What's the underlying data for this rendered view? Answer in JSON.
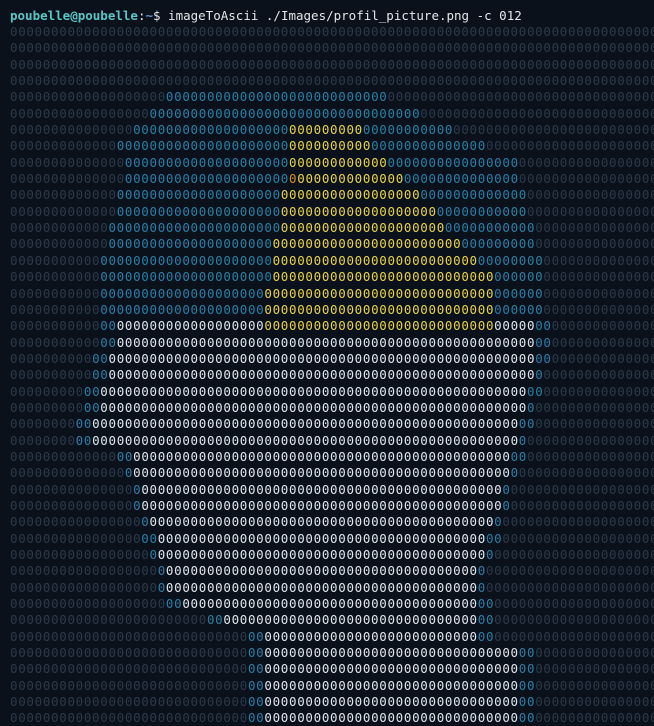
{
  "prompt": {
    "user_host": "poubelle@poubelle",
    "separator": ":",
    "path": "~",
    "symbol": "$",
    "command": " imageToAscii ./Images/profil_picture.png -c 012"
  },
  "ascii": {
    "columns": 79,
    "rows": [
      "0000000000000000000000000000000000000000000000000000000000000000000000000000000",
      "0000000000000000000000000000000000000000000000000000000000000000000000000000000",
      "0000000000000000000000000000000000000000000000000000000000000000000000000000000",
      "0000000000000000000000000000000000000000000000000000000000000000000000000000000",
      "0000000000000000000000000000000000000000000000000000000000000000000000000000000",
      "0000000000000000000000000000000000000000000000000000000000000000000000000000000",
      "0000000000000000000000000000000000000000000000000000000000000000000000000000000",
      "0000000000000000000000000000000000000000000000000000000000000000000000000000000",
      "0000000000000000000000000000000000000000000000000000000000000000000000000000000",
      "0000000000000000000000000000000000000000000000000000000000000000000000000000000",
      "0000000000000000000000000000000000000000000000000000000000000000000000000000000",
      "0000000000000000000000000000000000000000000000000000000000000000000000000000000",
      "0000000000000000000000000000000000000000000000000000000000000000000000000000000",
      "0000000000000000000000000000000000000000000000000000000000000000000000000000000",
      "0000000000000000000000000000000000000000000000000000000000000000000000000000000",
      "0000000000000000000000000000000000000000000000000000000000000000000000000000000",
      "0000000000000000000000000000000000000000000000000000000000000000000000000000000",
      "0000000000000000000000000000000000000000000000000000000000000000000000000000000",
      "0000000000000000000000000000000000000000000000000000000000000000000000000000000",
      "0000000000000000000000000000000000000000000000000000000000000000000000000000000",
      "0000000000000000000000000000000000000000000000000000000000000000000000000000000",
      "0000000000000000000000000000000000000000000000000000000000000000000000000000000",
      "0000000000000000000000000000000000000000000000000000000000000000000000000000000",
      "0000000000000000000000000000000000000000000000000000000000000000000000000000000",
      "0000000000000000000000000000000000000000000000000000000000000000000000000000000",
      "0000000000000000000000000000000000000000000000000000000000000000000000000000000",
      "0000000000000000000000000000000000000000000000000000000000000000000000000000000",
      "0000000000000000000000000000000000000000000000000000000000000000000000000000000",
      "0000000000000000000000000000000000000000000000000000000000000000000000000000000",
      "0000000000000000000000000000000000000000000000000000000000000000000000000000000",
      "0000000000000000000000000000000000000000000000000000000000000000000000000000000",
      "0000000000000000000000000000000000000000000000000000000000000000000000000000000",
      "0000000000000000000000000000000000000000000000000000000000000000000000000000000",
      "0000000000000000000000000000000000000000000000000000000000000000000000000000000",
      "0000000000000000000000000000000000000000000000000000000000000000000000000000000",
      "0000000000000000000000000000000000000000000000000000000000000000000000000000000",
      "0000000000000000000000000000000000000000000000000000000000000000000000000000000",
      "0000000000000000000000000000000000000000000000000000000000000000000000000000000",
      "0000000000000000000000000000000000000000000000000000000000000000000000000000000",
      "0000000000000000000000000000000000000000000000000000000000000000000000000000000",
      "0000000000000000000000000000000000000000000000000000000000000000000000000000000",
      "0000000000000000000000000000000000000000000000000000000000000000000000000000000",
      "0000000000000000000000000000000000000000000000000000000000000000000000000000000"
    ],
    "colors": {
      "background": "#0b111a",
      "dark": "#2c3a4b",
      "blue": "#2a7fa6",
      "white": "#e0e6ee",
      "yellow": "#e7d24e",
      "orange": "#e08a22"
    }
  }
}
